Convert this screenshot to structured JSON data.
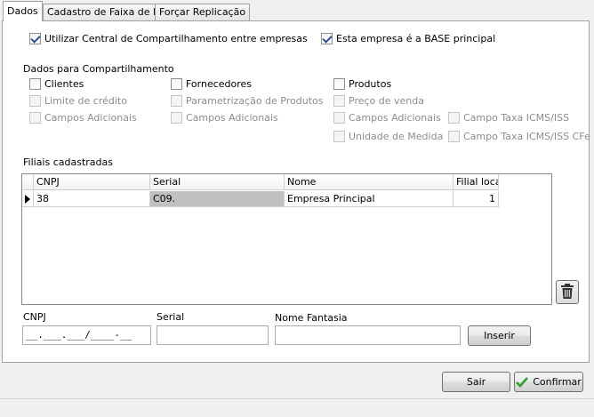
{
  "tabs": [
    "Dados",
    "Cadastro de Faixa de ID",
    "Forçar Replicação"
  ],
  "options": {
    "central_label": "Utilizar Central de Compartilhamento entre empresas",
    "central_checked": true,
    "base_label": "Esta empresa é a BASE principal",
    "base_checked": true
  },
  "sharing": {
    "title": "Dados para Compartilhamento",
    "clientes": "Clientes",
    "limite_credito": "Limite de crédito",
    "campos_adicionais_clientes": "Campos Adicionais",
    "fornecedores": "Fornecedores",
    "parametrizacao_produtos": "Parametrização de Produtos",
    "campos_adicionais_fornecedores": "Campos Adicionais",
    "produtos": "Produtos",
    "preco_venda": "Preço de venda",
    "campos_adicionais_produtos": "Campos Adicionais",
    "unidade_medida": "Unidade de Medida",
    "campo_taxa_icms": "Campo Taxa ICMS/ISS",
    "campo_taxa_icms_cfe": "Campo Taxa ICMS/ISS CFe"
  },
  "filiais": {
    "title": "Filiais cadastradas",
    "columns": [
      "CNPJ",
      "Serial",
      "Nome",
      "Filial local"
    ],
    "rows": [
      {
        "cnpj": "38",
        "serial": "C09.",
        "nome": "Empresa Principal",
        "filial_local": "1"
      }
    ]
  },
  "form": {
    "cnpj_label": "CNPJ",
    "cnpj_value": "__.___.___/____-__",
    "serial_label": "Serial",
    "serial_value": "",
    "nome_label": "Nome Fantasia",
    "nome_value": "",
    "inserir": "Inserir"
  },
  "footer": {
    "sair": "Sair",
    "confirmar": "Confirmar"
  },
  "icons": {
    "delete": "trash-icon",
    "confirm": "checkmark-icon"
  },
  "colors": {
    "confirm_check": "#2e9d2e",
    "selected_serial": "#c0c0c0"
  }
}
